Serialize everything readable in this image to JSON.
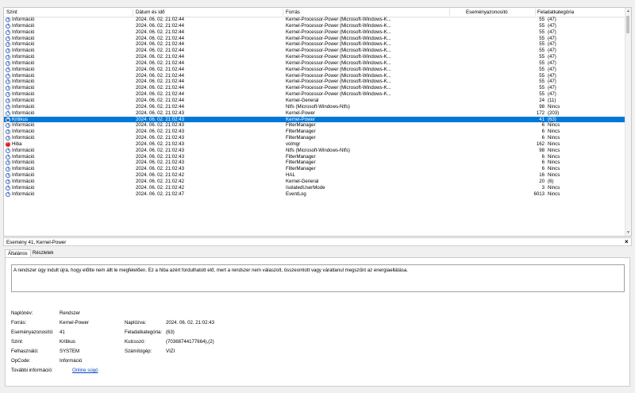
{
  "columns": {
    "level": "Szint",
    "date": "Dátum és idő",
    "source": "Forrás",
    "event_id": "Eseményazonosító",
    "category": "Feladatkategória"
  },
  "rows": [
    {
      "icon": "info",
      "level": "Információ",
      "date": "2024. 06. 02. 21:02:44",
      "source": "Kernel-Processor-Power (Microsoft-Windows-K...",
      "id": "55",
      "cat": "(47)"
    },
    {
      "icon": "info",
      "level": "Információ",
      "date": "2024. 06. 02. 21:02:44",
      "source": "Kernel-Processor-Power (Microsoft-Windows-K...",
      "id": "55",
      "cat": "(47)"
    },
    {
      "icon": "info",
      "level": "Információ",
      "date": "2024. 06. 02. 21:02:44",
      "source": "Kernel-Processor-Power (Microsoft-Windows-K...",
      "id": "55",
      "cat": "(47)"
    },
    {
      "icon": "info",
      "level": "Információ",
      "date": "2024. 06. 02. 21:02:44",
      "source": "Kernel-Processor-Power (Microsoft-Windows-K...",
      "id": "55",
      "cat": "(47)"
    },
    {
      "icon": "info",
      "level": "Információ",
      "date": "2024. 06. 02. 21:02:44",
      "source": "Kernel-Processor-Power (Microsoft-Windows-K...",
      "id": "55",
      "cat": "(47)"
    },
    {
      "icon": "info",
      "level": "Információ",
      "date": "2024. 06. 02. 21:02:44",
      "source": "Kernel-Processor-Power (Microsoft-Windows-K...",
      "id": "55",
      "cat": "(47)"
    },
    {
      "icon": "info",
      "level": "Információ",
      "date": "2024. 06. 02. 21:02:44",
      "source": "Kernel-Processor-Power (Microsoft-Windows-K...",
      "id": "55",
      "cat": "(47)"
    },
    {
      "icon": "info",
      "level": "Információ",
      "date": "2024. 06. 02. 21:02:44",
      "source": "Kernel-Processor-Power (Microsoft-Windows-K...",
      "id": "55",
      "cat": "(47)"
    },
    {
      "icon": "info",
      "level": "Információ",
      "date": "2024. 06. 02. 21:02:44",
      "source": "Kernel-Processor-Power (Microsoft-Windows-K...",
      "id": "55",
      "cat": "(47)"
    },
    {
      "icon": "info",
      "level": "Információ",
      "date": "2024. 06. 02. 21:02:44",
      "source": "Kernel-Processor-Power (Microsoft-Windows-K...",
      "id": "55",
      "cat": "(47)"
    },
    {
      "icon": "info",
      "level": "Információ",
      "date": "2024. 06. 02. 21:02:44",
      "source": "Kernel-Processor-Power (Microsoft-Windows-K...",
      "id": "55",
      "cat": "(47)"
    },
    {
      "icon": "info",
      "level": "Információ",
      "date": "2024. 06. 02. 21:02:44",
      "source": "Kernel-Processor-Power (Microsoft-Windows-K...",
      "id": "55",
      "cat": "(47)"
    },
    {
      "icon": "info",
      "level": "Információ",
      "date": "2024. 06. 02. 21:02:44",
      "source": "Kernel-Processor-Power (Microsoft-Windows-K...",
      "id": "55",
      "cat": "(47)"
    },
    {
      "icon": "info",
      "level": "Információ",
      "date": "2024. 06. 02. 21:02:44",
      "source": "Kernel-General",
      "id": "24",
      "cat": "(11)"
    },
    {
      "icon": "info",
      "level": "Információ",
      "date": "2024. 06. 02. 21:02:44",
      "source": "Ntfs (Microsoft-Windows-Ntfs)",
      "id": "98",
      "cat": "Nincs"
    },
    {
      "icon": "info",
      "level": "Információ",
      "date": "2024. 06. 02. 21:02:43",
      "source": "Kernel-Power",
      "id": "172",
      "cat": "(203)"
    },
    {
      "icon": "crit",
      "level": "Kritikus",
      "date": "2024. 06. 02. 21:02:43",
      "source": "Kernel-Power",
      "id": "41",
      "cat": "(63)",
      "selected": true
    },
    {
      "icon": "info",
      "level": "Információ",
      "date": "2024. 06. 02. 21:02:43",
      "source": "FilterManager",
      "id": "6",
      "cat": "Nincs"
    },
    {
      "icon": "info",
      "level": "Információ",
      "date": "2024. 06. 02. 21:02:43",
      "source": "FilterManager",
      "id": "6",
      "cat": "Nincs"
    },
    {
      "icon": "info",
      "level": "Információ",
      "date": "2024. 06. 02. 21:02:43",
      "source": "FilterManager",
      "id": "6",
      "cat": "Nincs"
    },
    {
      "icon": "err",
      "level": "Hiba",
      "date": "2024. 06. 02. 21:02:43",
      "source": "volmgr",
      "id": "162",
      "cat": "Nincs"
    },
    {
      "icon": "info",
      "level": "Információ",
      "date": "2024. 06. 02. 21:02:43",
      "source": "Ntfs (Microsoft-Windows-Ntfs)",
      "id": "98",
      "cat": "Nincs"
    },
    {
      "icon": "info",
      "level": "Információ",
      "date": "2024. 06. 02. 21:02:43",
      "source": "FilterManager",
      "id": "6",
      "cat": "Nincs"
    },
    {
      "icon": "info",
      "level": "Információ",
      "date": "2024. 06. 02. 21:02:43",
      "source": "FilterManager",
      "id": "6",
      "cat": "Nincs"
    },
    {
      "icon": "info",
      "level": "Információ",
      "date": "2024. 06. 02. 21:02:43",
      "source": "FilterManager",
      "id": "6",
      "cat": "Nincs"
    },
    {
      "icon": "info",
      "level": "Információ",
      "date": "2024. 06. 02. 21:02:42",
      "source": "HAL",
      "id": "16",
      "cat": "Nincs"
    },
    {
      "icon": "info",
      "level": "Információ",
      "date": "2024. 06. 02. 21:02:42",
      "source": "Kernel-General",
      "id": "20",
      "cat": "(6)"
    },
    {
      "icon": "info",
      "level": "Információ",
      "date": "2024. 06. 02. 21:02:42",
      "source": "IsolatedUserMode",
      "id": "3",
      "cat": "Nincs"
    },
    {
      "icon": "info",
      "level": "Információ",
      "date": "2024. 06. 02. 21:02:47",
      "source": "EventLog",
      "id": "6013",
      "cat": "Nincs"
    }
  ],
  "panel": {
    "title": "Esemény 41, Kernel-Power",
    "tab_general": "Általános",
    "tab_details": "Részletek",
    "description": "A rendszer úgy indult újra, hogy előtte nem állt le megfelelően. Ez a hiba azért fordulhatott elő, mert a rendszer nem válaszolt, összeomlott vagy váratlanul megszűnt az energiaellátása.",
    "log_label": "Naplónév:",
    "log_value": "Rendszer",
    "source_label": "Forrás:",
    "source_value": "Kernel-Power",
    "logged_label": "Naplózva:",
    "logged_value": "2024. 06. 02. 21:02:43",
    "eventid_label": "Eseményazonosító:",
    "eventid_value": "41",
    "taskcat_label": "Feladatkategória:",
    "taskcat_value": "(63)",
    "level_label": "Szint:",
    "level_value": "Kritikus",
    "keywords_label": "Kulcsszó:",
    "keywords_value": "(70368744177664),(2)",
    "user_label": "Felhasználó:",
    "user_value": "SYSTEM",
    "computer_label": "Számítógép:",
    "computer_value": "VIZI",
    "opcode_label": "OpCode:",
    "opcode_value": "Információ",
    "moreinfo_label": "További információ:",
    "moreinfo_link": "Online súgó"
  },
  "colors": {
    "selection": "#0078d7",
    "link": "#0645c8"
  }
}
